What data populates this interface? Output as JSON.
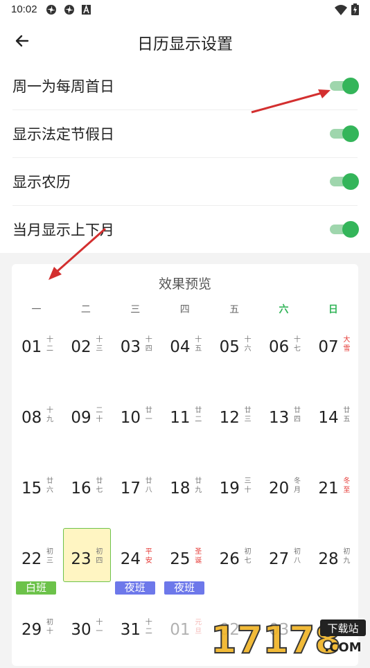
{
  "status_bar": {
    "time": "10:02",
    "icons": [
      "pinwheel-icon",
      "pinwheel-icon",
      "a-icon",
      "wifi-icon",
      "battery-icon"
    ]
  },
  "header": {
    "title": "日历显示设置",
    "back_icon": "arrow-left-icon"
  },
  "settings": [
    {
      "label": "周一为每周首日",
      "on": true
    },
    {
      "label": "显示法定节假日",
      "on": true
    },
    {
      "label": "显示农历",
      "on": true
    },
    {
      "label": "当月显示上下月",
      "on": true
    }
  ],
  "preview": {
    "title": "效果预览",
    "weekdays": [
      "一",
      "二",
      "三",
      "四",
      "五",
      "六",
      "日"
    ],
    "weeks": [
      [
        {
          "num": "01",
          "lunar": "十二",
          "red": false
        },
        {
          "num": "02",
          "lunar": "十三",
          "red": false
        },
        {
          "num": "03",
          "lunar": "十四",
          "red": false
        },
        {
          "num": "04",
          "lunar": "十五",
          "red": false
        },
        {
          "num": "05",
          "lunar": "十六",
          "red": false
        },
        {
          "num": "06",
          "lunar": "十七",
          "red": false
        },
        {
          "num": "07",
          "lunar": "大雪",
          "red": true
        }
      ],
      [
        {
          "num": "08",
          "lunar": "十九",
          "red": false
        },
        {
          "num": "09",
          "lunar": "二十",
          "red": false
        },
        {
          "num": "10",
          "lunar": "廿一",
          "red": false
        },
        {
          "num": "11",
          "lunar": "廿二",
          "red": false
        },
        {
          "num": "12",
          "lunar": "廿三",
          "red": false
        },
        {
          "num": "13",
          "lunar": "廿四",
          "red": false
        },
        {
          "num": "14",
          "lunar": "廿五",
          "red": false
        }
      ],
      [
        {
          "num": "15",
          "lunar": "廿六",
          "red": false
        },
        {
          "num": "16",
          "lunar": "廿七",
          "red": false
        },
        {
          "num": "17",
          "lunar": "廿八",
          "red": false
        },
        {
          "num": "18",
          "lunar": "廿九",
          "red": false
        },
        {
          "num": "19",
          "lunar": "三十",
          "red": false
        },
        {
          "num": "20",
          "lunar": "冬月",
          "red": false
        },
        {
          "num": "21",
          "lunar": "冬至",
          "red": true
        }
      ],
      [
        {
          "num": "22",
          "lunar": "初三",
          "red": false,
          "badge": "白班",
          "badge_color": "green"
        },
        {
          "num": "23",
          "lunar": "初四",
          "red": false,
          "selected": true
        },
        {
          "num": "24",
          "lunar": "平安",
          "red": true,
          "badge": "夜班",
          "badge_color": "blue"
        },
        {
          "num": "25",
          "lunar": "圣诞",
          "red": true,
          "badge": "夜班",
          "badge_color": "blue"
        },
        {
          "num": "26",
          "lunar": "初七",
          "red": false
        },
        {
          "num": "27",
          "lunar": "初八",
          "red": false
        },
        {
          "num": "28",
          "lunar": "初九",
          "red": false
        }
      ],
      [
        {
          "num": "29",
          "lunar": "初十",
          "red": false
        },
        {
          "num": "30",
          "lunar": "十一",
          "red": false
        },
        {
          "num": "31",
          "lunar": "十二",
          "red": false
        },
        {
          "num": "01",
          "lunar": "元旦",
          "red": true,
          "faded": true
        },
        {
          "num": "02",
          "lunar": "",
          "red": false,
          "faded": true
        },
        {
          "num": "03",
          "lunar": "",
          "red": false,
          "faded": true
        },
        {
          "num": "04",
          "lunar": "",
          "red": false,
          "faded": true
        }
      ]
    ]
  },
  "colors": {
    "accent_green": "#34b55a",
    "arrow_red": "#d32f2f",
    "badge_blue": "#6d78ea",
    "badge_green": "#6cc24a"
  },
  "watermark": {
    "text": "17178",
    "label": "下载站",
    "domain": ".COM"
  }
}
